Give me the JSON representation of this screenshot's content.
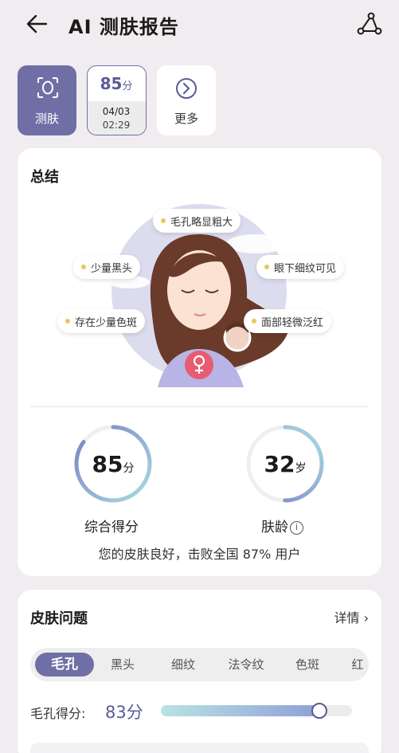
{
  "header": {
    "title": "AI 测肤报告",
    "back_icon": "back-arrow-icon",
    "share_icon": "share-icon"
  },
  "tiles": {
    "measure": {
      "label": "测肤",
      "icon": "face-scan-icon"
    },
    "record": {
      "score": "85",
      "score_unit": "分",
      "date": "04/03",
      "time": "02:29"
    },
    "more": {
      "label": "更多",
      "icon": "chevron-right-circle-icon"
    }
  },
  "summary": {
    "title": "总结",
    "tags": [
      "毛孔略显粗大",
      "少量黑头",
      "眼下细纹可见",
      "存在少量色斑",
      "面部轻微泛红"
    ],
    "overall_score": {
      "value": "85",
      "unit": "分",
      "label": "综合得分",
      "fraction": 0.85
    },
    "skin_age": {
      "value": "32",
      "unit": "岁",
      "label": "肤龄",
      "fraction": 0.5
    },
    "beat_text": "您的皮肤良好，击败全国 87% 用户",
    "gender_icon": "female-icon"
  },
  "issues": {
    "title": "皮肤问题",
    "detail_label": "详情",
    "tabs": [
      "毛孔",
      "黑头",
      "细纹",
      "法令纹",
      "色斑",
      "红"
    ],
    "active_tab": "毛孔",
    "pore_label": "毛孔得分:",
    "pore_score": "83分",
    "pore_fraction": 0.83
  },
  "colors": {
    "accent": "#6f6fa6",
    "accent_text": "#5b5b96",
    "background": "#f1ecef",
    "tag_dot": "#e6c95a"
  }
}
